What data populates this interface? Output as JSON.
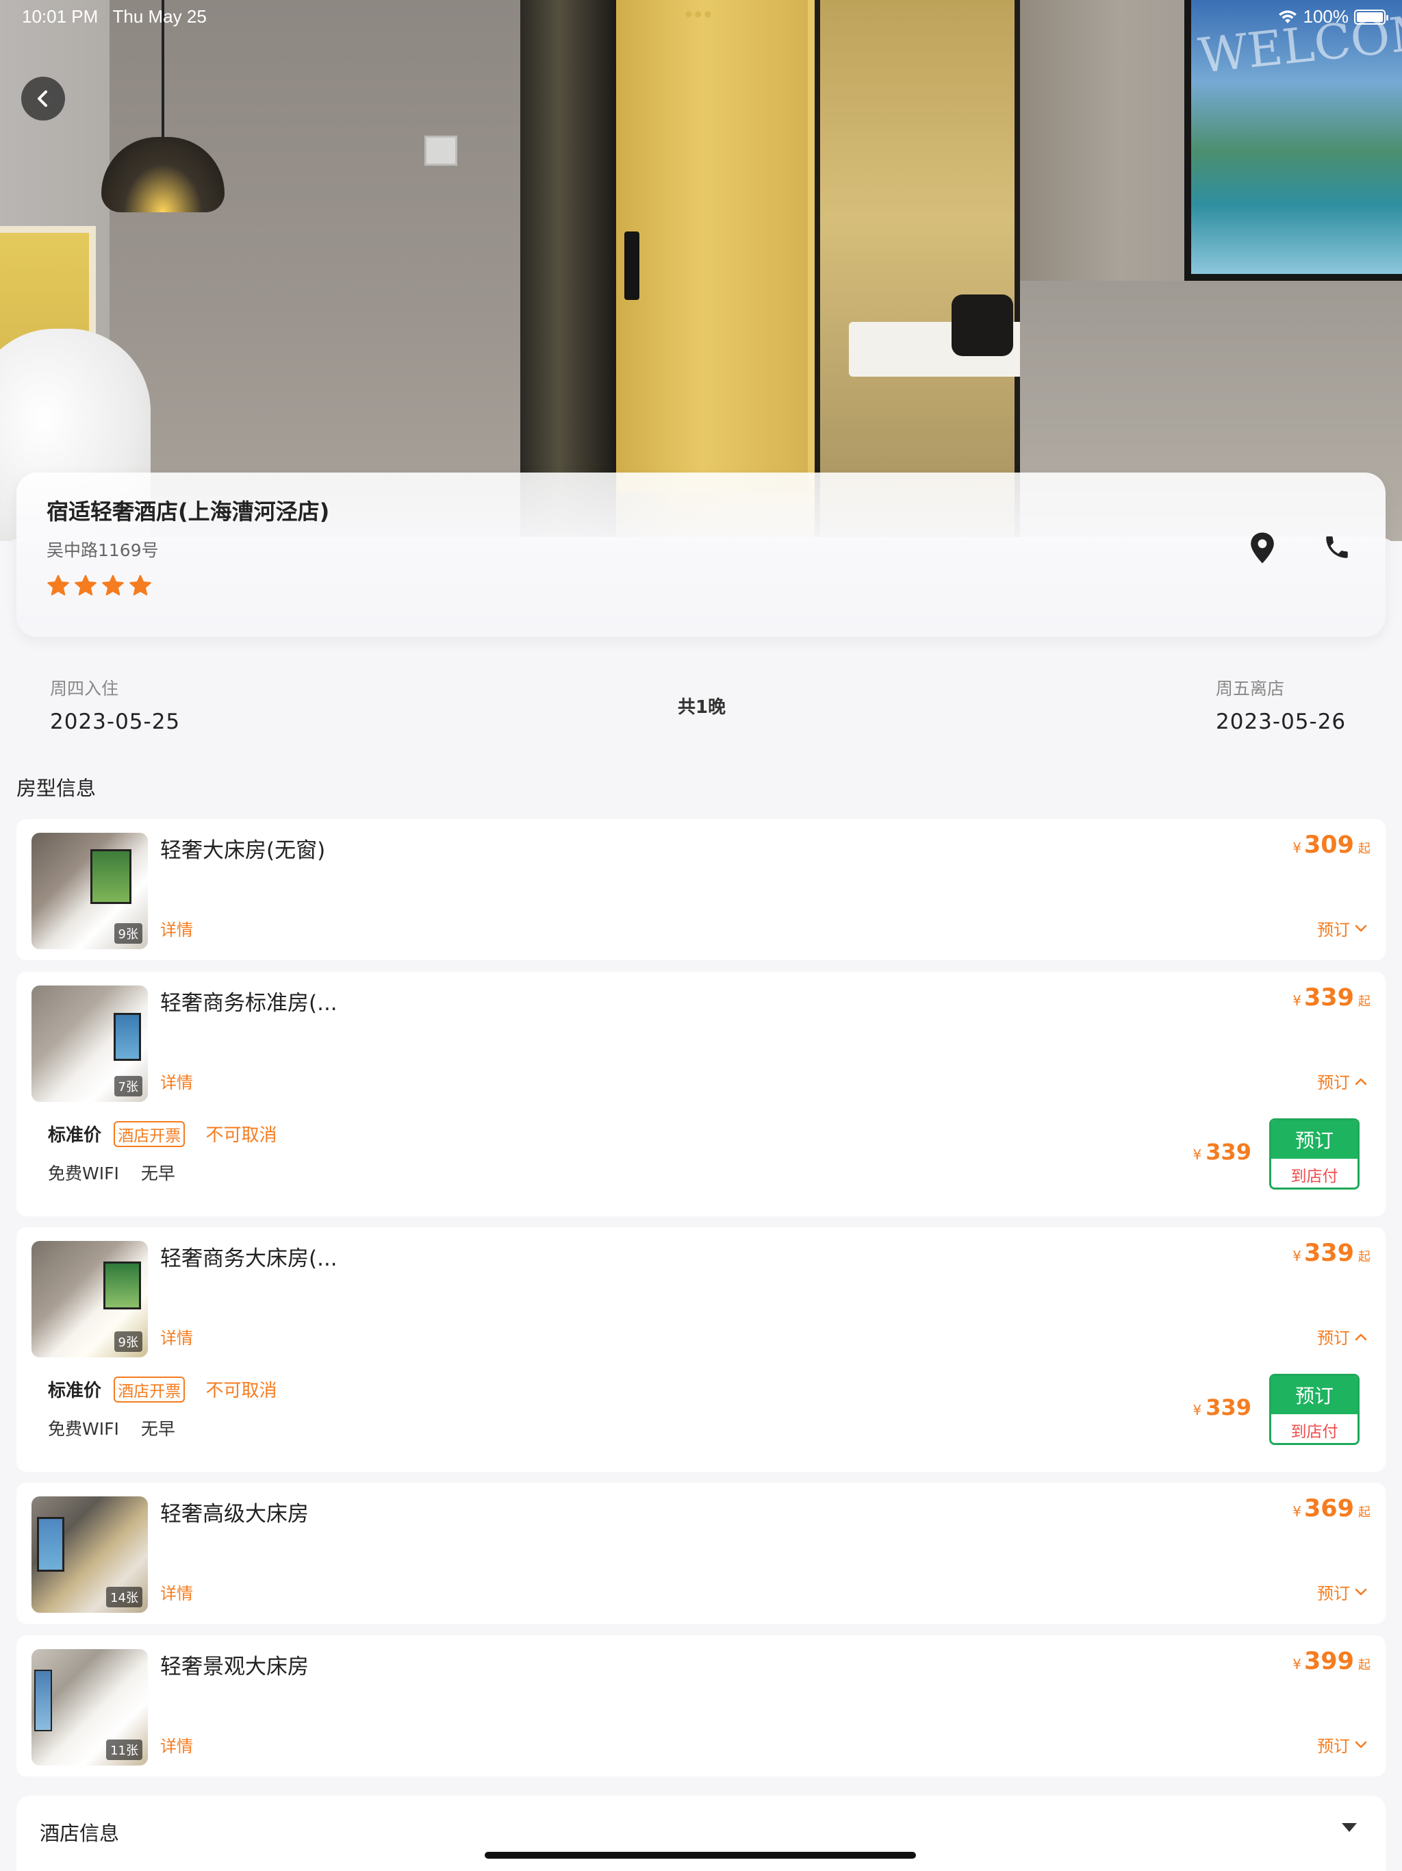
{
  "status_bar": {
    "time": "10:01 PM",
    "date": "Thu May 25",
    "multitask_dots": "•••",
    "battery": "100%"
  },
  "hero": {
    "tv_text": "WELCOME"
  },
  "hotel": {
    "name": "宿适轻奢酒店(上海漕河泾店)",
    "address": "吴中路1169号",
    "star_rating": 4,
    "accent_color": "#f57c1f"
  },
  "stay": {
    "checkin_label": "周四入住",
    "checkin_date": "2023-05-25",
    "nights": "共1晚",
    "checkout_label": "周五离店",
    "checkout_date": "2023-05-26"
  },
  "rooms_section_title": "房型信息",
  "rooms": [
    {
      "name": "轻奢大床房(无窗)",
      "photo_count": "9张",
      "detail_label": "详情",
      "currency": "¥",
      "price": "309",
      "price_suffix": "起",
      "toggle_label": "预订",
      "expanded": false
    },
    {
      "name": "轻奢商务标准房(...",
      "photo_count": "7张",
      "detail_label": "详情",
      "currency": "¥",
      "price": "339",
      "price_suffix": "起",
      "toggle_label": "预订",
      "expanded": true,
      "rate": {
        "name": "标准价",
        "tag": "酒店开票",
        "cancel": "不可取消",
        "features": [
          "免费WIFI",
          "无早"
        ],
        "currency": "¥",
        "price": "339",
        "book_label": "预订",
        "pay_label": "到店付"
      }
    },
    {
      "name": "轻奢商务大床房(...",
      "photo_count": "9张",
      "detail_label": "详情",
      "currency": "¥",
      "price": "339",
      "price_suffix": "起",
      "toggle_label": "预订",
      "expanded": true,
      "rate": {
        "name": "标准价",
        "tag": "酒店开票",
        "cancel": "不可取消",
        "features": [
          "免费WIFI",
          "无早"
        ],
        "currency": "¥",
        "price": "339",
        "book_label": "预订",
        "pay_label": "到店付"
      }
    },
    {
      "name": "轻奢高级大床房",
      "photo_count": "14张",
      "detail_label": "详情",
      "currency": "¥",
      "price": "369",
      "price_suffix": "起",
      "toggle_label": "预订",
      "expanded": false
    },
    {
      "name": "轻奢景观大床房",
      "photo_count": "11张",
      "detail_label": "详情",
      "currency": "¥",
      "price": "399",
      "price_suffix": "起",
      "toggle_label": "预订",
      "expanded": false
    }
  ],
  "hotel_info": {
    "title": "酒店信息"
  },
  "icons": {
    "back": "chevron-left-icon",
    "location": "map-pin-icon",
    "phone": "phone-icon",
    "star": "star-icon",
    "wifi": "wifi-icon",
    "battery": "battery-icon",
    "chevron_down": "chevron-down-icon",
    "chevron_up": "chevron-up-icon",
    "caret_down": "caret-down-icon"
  },
  "colors": {
    "book_green": "#1eb35f",
    "pay_red": "#f24b4b"
  }
}
